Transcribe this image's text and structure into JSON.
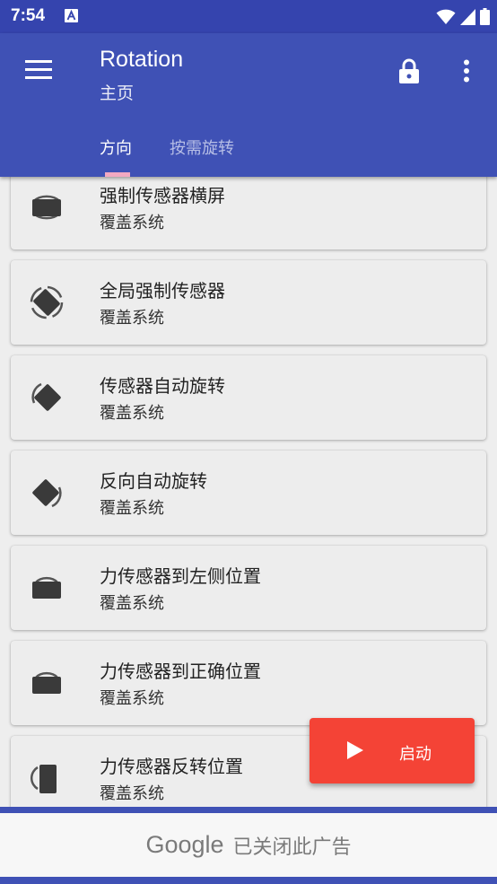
{
  "status_bar": {
    "time": "7:54",
    "icons": [
      "font-notification-icon",
      "wifi-icon",
      "signal-icon",
      "battery-icon"
    ]
  },
  "app_bar": {
    "title": "Rotation",
    "subtitle": "主页",
    "menu_icon": "hamburger-menu-icon",
    "lock_icon": "lock-icon",
    "more_icon": "more-vert-icon"
  },
  "tabs": [
    {
      "label": "方向",
      "selected": true
    },
    {
      "label": "按需旋转",
      "selected": false
    }
  ],
  "list": {
    "items": [
      {
        "title": "强制传感器横屏",
        "subtitle": "覆盖系统",
        "icon": "sensor-landscape-icon"
      },
      {
        "title": "全局强制传感器",
        "subtitle": "覆盖系统",
        "icon": "full-sensor-rotate-icon"
      },
      {
        "title": "传感器自动旋转",
        "subtitle": "覆盖系统",
        "icon": "auto-rotate-icon"
      },
      {
        "title": "反向自动旋转",
        "subtitle": "覆盖系统",
        "icon": "reverse-auto-rotate-icon"
      },
      {
        "title": "力传感器到左侧位置",
        "subtitle": "覆盖系统",
        "icon": "sensor-left-icon"
      },
      {
        "title": "力传感器到正确位置",
        "subtitle": "覆盖系统",
        "icon": "sensor-right-icon"
      },
      {
        "title": "力传感器反转位置",
        "subtitle": "覆盖系统",
        "icon": "sensor-reverse-icon"
      }
    ]
  },
  "fab": {
    "label": "启动",
    "icon": "play-icon"
  },
  "ad": {
    "brand": "Google",
    "text": "已关闭此广告"
  },
  "colors": {
    "primary": "#3F51B5",
    "primary_dark": "#3544AE",
    "accent_indicator": "#F2A9C2",
    "fab": "#F44336",
    "background": "#EEEEEE"
  }
}
